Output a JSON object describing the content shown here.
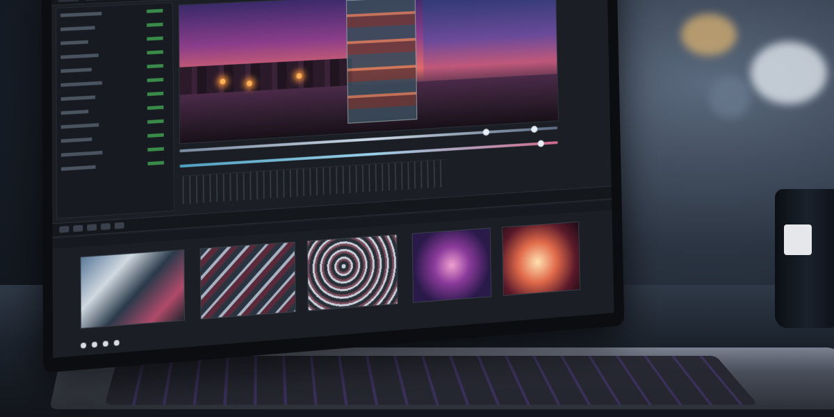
{
  "scene": {
    "colors": {
      "accent_purple": "#8a3d8a",
      "accent_orange": "#ff9a3a",
      "ui_background": "#1b1f25",
      "track_value_green": "#58c46a"
    }
  },
  "editor": {
    "side_panel": {
      "tracks": []
    },
    "viewer": {},
    "toolbar": {
      "icons": [
        "cut-icon",
        "trim-icon",
        "play-icon",
        "marker-icon",
        "settings-icon"
      ]
    },
    "clips": [
      {
        "id": "clip-1"
      },
      {
        "id": "clip-2"
      },
      {
        "id": "clip-3"
      },
      {
        "id": "clip-4"
      },
      {
        "id": "clip-5"
      }
    ]
  }
}
